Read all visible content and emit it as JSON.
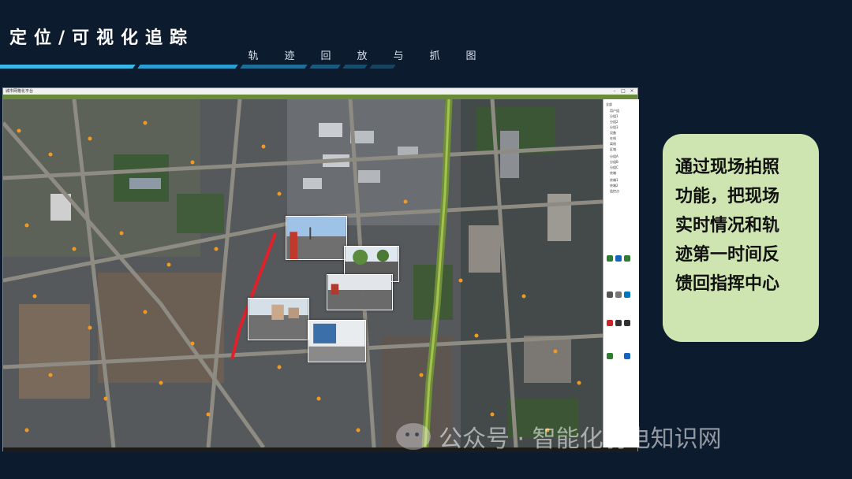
{
  "slide": {
    "title": "定位/可视化追踪",
    "subtitle_chars": [
      "轨",
      "迹",
      "回",
      "放",
      "与",
      "抓",
      "图"
    ]
  },
  "app": {
    "window_title": "城市网格化平台",
    "controls": {
      "minimize": "–",
      "maximize": "□",
      "close": "×"
    },
    "tree_items": [
      "全部",
      "用户组",
      "分组1",
      "分组2",
      "分组3",
      "设备",
      "在线",
      "离线",
      "区域",
      "分组A",
      "分组B",
      "分组C",
      "终端",
      "终端1",
      "终端2",
      "监控点"
    ]
  },
  "callout": {
    "lines": [
      "通过现场拍照",
      "功能，把现场",
      "实时情况和轨",
      "迹第一时间反",
      "馈回指挥中心"
    ]
  },
  "watermark": {
    "text": "公众号 · 智能化弱电知识网"
  },
  "colors": {
    "background": "#0d1b2e",
    "accent": "#3ab9e8",
    "callout_bg": "#cfe5b1",
    "track": "#e0202a",
    "marker": "#f29a1f"
  },
  "icons": [
    "wechat-logo-icon",
    "window-minimize-icon",
    "window-maximize-icon",
    "window-close-icon"
  ]
}
